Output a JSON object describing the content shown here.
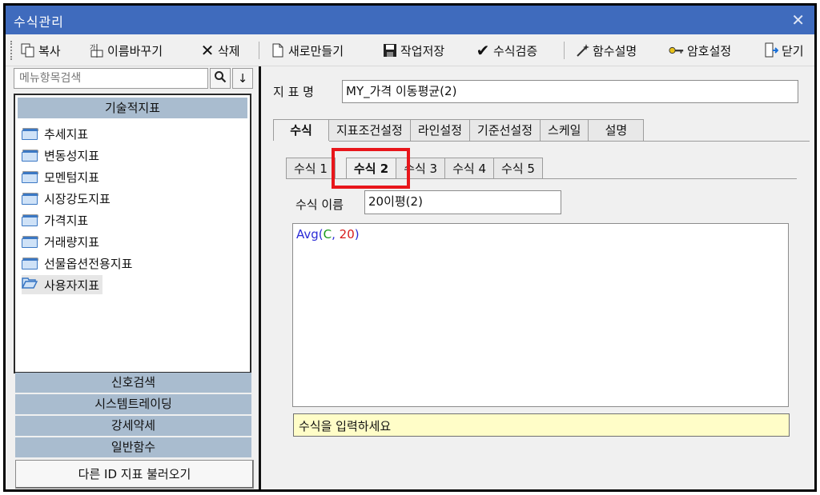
{
  "window": {
    "title": "수식관리"
  },
  "toolbar": {
    "copy": "복사",
    "rename": "이름바꾸기",
    "delete": "삭제",
    "new": "새로만들기",
    "save": "작업저장",
    "verify": "수식검증",
    "func_desc": "함수설명",
    "password": "암호설정",
    "close": "닫기"
  },
  "sidebar": {
    "search_placeholder": "메뉴항목검색",
    "header": "기술적지표",
    "items": [
      {
        "label": "추세지표"
      },
      {
        "label": "변동성지표"
      },
      {
        "label": "모멘텀지표"
      },
      {
        "label": "시장강도지표"
      },
      {
        "label": "가격지표"
      },
      {
        "label": "거래량지표"
      },
      {
        "label": "선물옵션전용지표"
      },
      {
        "label": "사용자지표"
      }
    ],
    "categories": [
      "신호검색",
      "시스템트레이딩",
      "강세약세",
      "일반함수"
    ],
    "import_button": "다른 ID 지표 불러오기"
  },
  "main": {
    "indicator_label": "지 표 명",
    "indicator_value": "MY_가격 이동평균(2)",
    "tabs": [
      "수식",
      "지표조건설정",
      "라인설정",
      "기준선설정",
      "스케일",
      "설명"
    ],
    "subtabs": [
      "수식 1",
      "수식 2",
      "수식 3",
      "수식 4",
      "수식 5"
    ],
    "formula_name_label": "수식 이름",
    "formula_name_value": "20이평(2)",
    "formula": {
      "fn": "Avg",
      "open": "(",
      "arg1": "C",
      "comma": ", ",
      "arg2": "20",
      "close": ")"
    },
    "hint": "수식을 입력하세요"
  },
  "colors": {
    "titlebar": "#3f6bbd",
    "category_bar": "#a9bccf",
    "hint_bg": "#fffdc8",
    "highlight": "#e8161b",
    "formula_fn": "#2b2bd6",
    "formula_var": "#1a9a1a",
    "formula_num": "#d81b1b"
  },
  "icons": [
    "copy-icon",
    "rename-icon",
    "delete-icon",
    "new-file-icon",
    "save-icon",
    "checkmark-icon",
    "magic-wand-icon",
    "key-icon",
    "exit-icon",
    "search-icon",
    "arrow-down-icon",
    "folder-icon",
    "folder-open-icon",
    "close-icon"
  ]
}
